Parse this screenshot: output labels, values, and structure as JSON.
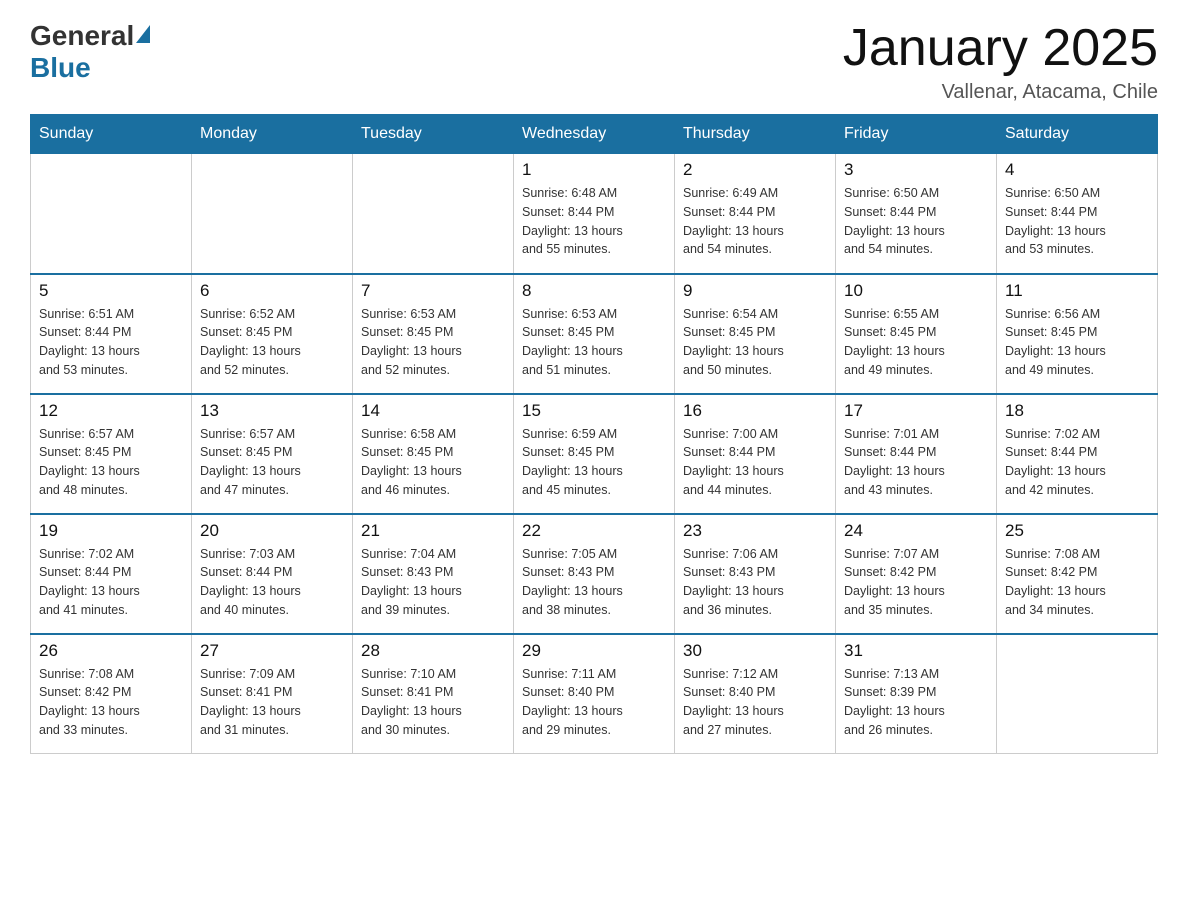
{
  "header": {
    "logo_general": "General",
    "logo_blue": "Blue",
    "title": "January 2025",
    "location": "Vallenar, Atacama, Chile"
  },
  "days_of_week": [
    "Sunday",
    "Monday",
    "Tuesday",
    "Wednesday",
    "Thursday",
    "Friday",
    "Saturday"
  ],
  "weeks": [
    [
      {
        "day": "",
        "info": ""
      },
      {
        "day": "",
        "info": ""
      },
      {
        "day": "",
        "info": ""
      },
      {
        "day": "1",
        "info": "Sunrise: 6:48 AM\nSunset: 8:44 PM\nDaylight: 13 hours\nand 55 minutes."
      },
      {
        "day": "2",
        "info": "Sunrise: 6:49 AM\nSunset: 8:44 PM\nDaylight: 13 hours\nand 54 minutes."
      },
      {
        "day": "3",
        "info": "Sunrise: 6:50 AM\nSunset: 8:44 PM\nDaylight: 13 hours\nand 54 minutes."
      },
      {
        "day": "4",
        "info": "Sunrise: 6:50 AM\nSunset: 8:44 PM\nDaylight: 13 hours\nand 53 minutes."
      }
    ],
    [
      {
        "day": "5",
        "info": "Sunrise: 6:51 AM\nSunset: 8:44 PM\nDaylight: 13 hours\nand 53 minutes."
      },
      {
        "day": "6",
        "info": "Sunrise: 6:52 AM\nSunset: 8:45 PM\nDaylight: 13 hours\nand 52 minutes."
      },
      {
        "day": "7",
        "info": "Sunrise: 6:53 AM\nSunset: 8:45 PM\nDaylight: 13 hours\nand 52 minutes."
      },
      {
        "day": "8",
        "info": "Sunrise: 6:53 AM\nSunset: 8:45 PM\nDaylight: 13 hours\nand 51 minutes."
      },
      {
        "day": "9",
        "info": "Sunrise: 6:54 AM\nSunset: 8:45 PM\nDaylight: 13 hours\nand 50 minutes."
      },
      {
        "day": "10",
        "info": "Sunrise: 6:55 AM\nSunset: 8:45 PM\nDaylight: 13 hours\nand 49 minutes."
      },
      {
        "day": "11",
        "info": "Sunrise: 6:56 AM\nSunset: 8:45 PM\nDaylight: 13 hours\nand 49 minutes."
      }
    ],
    [
      {
        "day": "12",
        "info": "Sunrise: 6:57 AM\nSunset: 8:45 PM\nDaylight: 13 hours\nand 48 minutes."
      },
      {
        "day": "13",
        "info": "Sunrise: 6:57 AM\nSunset: 8:45 PM\nDaylight: 13 hours\nand 47 minutes."
      },
      {
        "day": "14",
        "info": "Sunrise: 6:58 AM\nSunset: 8:45 PM\nDaylight: 13 hours\nand 46 minutes."
      },
      {
        "day": "15",
        "info": "Sunrise: 6:59 AM\nSunset: 8:45 PM\nDaylight: 13 hours\nand 45 minutes."
      },
      {
        "day": "16",
        "info": "Sunrise: 7:00 AM\nSunset: 8:44 PM\nDaylight: 13 hours\nand 44 minutes."
      },
      {
        "day": "17",
        "info": "Sunrise: 7:01 AM\nSunset: 8:44 PM\nDaylight: 13 hours\nand 43 minutes."
      },
      {
        "day": "18",
        "info": "Sunrise: 7:02 AM\nSunset: 8:44 PM\nDaylight: 13 hours\nand 42 minutes."
      }
    ],
    [
      {
        "day": "19",
        "info": "Sunrise: 7:02 AM\nSunset: 8:44 PM\nDaylight: 13 hours\nand 41 minutes."
      },
      {
        "day": "20",
        "info": "Sunrise: 7:03 AM\nSunset: 8:44 PM\nDaylight: 13 hours\nand 40 minutes."
      },
      {
        "day": "21",
        "info": "Sunrise: 7:04 AM\nSunset: 8:43 PM\nDaylight: 13 hours\nand 39 minutes."
      },
      {
        "day": "22",
        "info": "Sunrise: 7:05 AM\nSunset: 8:43 PM\nDaylight: 13 hours\nand 38 minutes."
      },
      {
        "day": "23",
        "info": "Sunrise: 7:06 AM\nSunset: 8:43 PM\nDaylight: 13 hours\nand 36 minutes."
      },
      {
        "day": "24",
        "info": "Sunrise: 7:07 AM\nSunset: 8:42 PM\nDaylight: 13 hours\nand 35 minutes."
      },
      {
        "day": "25",
        "info": "Sunrise: 7:08 AM\nSunset: 8:42 PM\nDaylight: 13 hours\nand 34 minutes."
      }
    ],
    [
      {
        "day": "26",
        "info": "Sunrise: 7:08 AM\nSunset: 8:42 PM\nDaylight: 13 hours\nand 33 minutes."
      },
      {
        "day": "27",
        "info": "Sunrise: 7:09 AM\nSunset: 8:41 PM\nDaylight: 13 hours\nand 31 minutes."
      },
      {
        "day": "28",
        "info": "Sunrise: 7:10 AM\nSunset: 8:41 PM\nDaylight: 13 hours\nand 30 minutes."
      },
      {
        "day": "29",
        "info": "Sunrise: 7:11 AM\nSunset: 8:40 PM\nDaylight: 13 hours\nand 29 minutes."
      },
      {
        "day": "30",
        "info": "Sunrise: 7:12 AM\nSunset: 8:40 PM\nDaylight: 13 hours\nand 27 minutes."
      },
      {
        "day": "31",
        "info": "Sunrise: 7:13 AM\nSunset: 8:39 PM\nDaylight: 13 hours\nand 26 minutes."
      },
      {
        "day": "",
        "info": ""
      }
    ]
  ]
}
